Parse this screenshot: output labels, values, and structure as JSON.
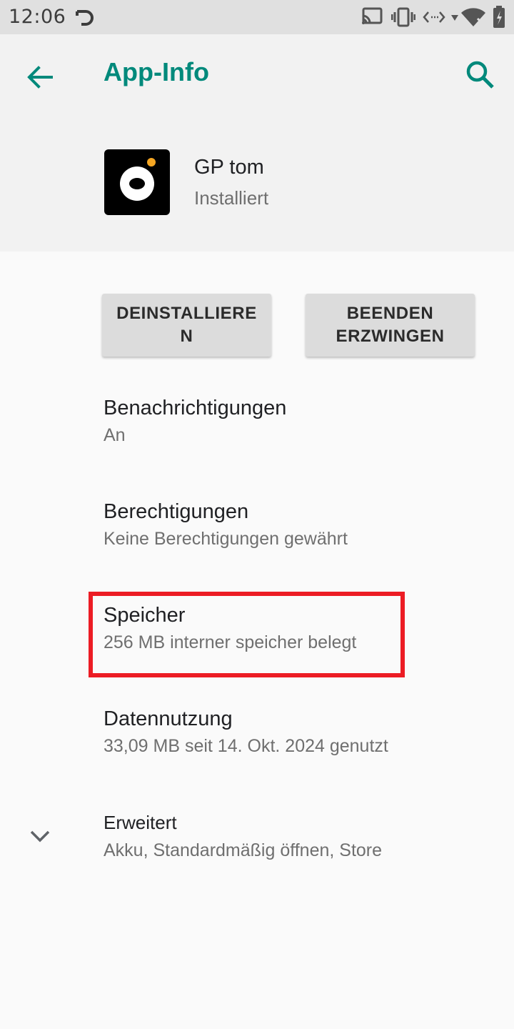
{
  "status_bar": {
    "time": "12:06",
    "icons": [
      "sync-icon",
      "cast-icon",
      "vibrate-icon",
      "data-arrows-icon",
      "wifi-icon",
      "battery-icon"
    ]
  },
  "header": {
    "title": "App-Info",
    "back_icon": "arrow-back-icon",
    "search_icon": "search-icon",
    "accent_color": "#00897b"
  },
  "app": {
    "name": "GP tom",
    "status": "Installiert"
  },
  "buttons": {
    "uninstall": "DEINSTALLIERE\nN",
    "force_stop": "BEENDEN\nERZWINGEN"
  },
  "items": [
    {
      "title": "Benachrichtigungen",
      "subtitle": "An"
    },
    {
      "title": "Berechtigungen",
      "subtitle": "Keine Berechtigungen gewährt"
    },
    {
      "title": "Speicher",
      "subtitle": "256 MB interner speicher belegt"
    },
    {
      "title": "Datennutzung",
      "subtitle": "33,09 MB seit 14. Okt. 2024 genutzt"
    },
    {
      "title": "Erweitert",
      "subtitle": "Akku, Standardmäßig öffnen, Store"
    }
  ],
  "highlight_color": "#ec1c24"
}
